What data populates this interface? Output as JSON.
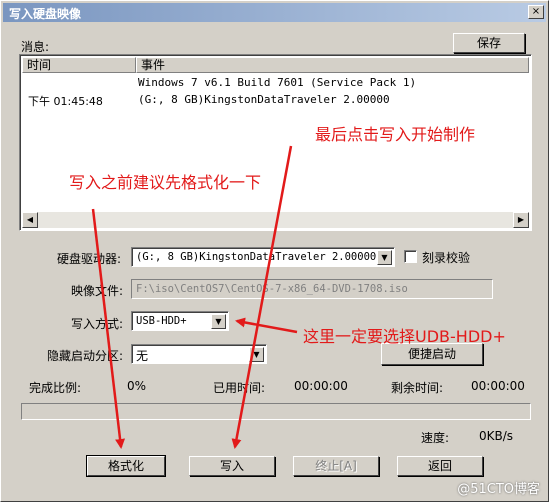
{
  "window": {
    "title": "写入硬盘映像",
    "close_glyph": "×"
  },
  "messages_label": "消息:",
  "save_button": "保存",
  "log": {
    "columns": [
      "时间",
      "事件"
    ],
    "rows": [
      {
        "time": "",
        "event": "Windows 7 v6.1 Build 7601 (Service Pack 1)"
      },
      {
        "time": "下午 01:45:48",
        "event": "(G:, 8 GB)KingstonDataTraveler 2.00000"
      }
    ]
  },
  "form": {
    "drive_label": "硬盘驱动器:",
    "drive_value": "(G:, 8 GB)KingstonDataTraveler 2.00000",
    "verify_label": "刻录校验",
    "image_label": "映像文件:",
    "image_value": "F:\\iso\\CentOS7\\CentOS-7-x86_64-DVD-1708.iso",
    "write_mode_label": "写入方式:",
    "write_mode_value": "USB-HDD+",
    "hidden_part_label": "隐藏启动分区:",
    "hidden_part_value": "无",
    "quick_boot_button": "便捷启动"
  },
  "status": {
    "ratio_label": "完成比例:",
    "ratio_value": "0%",
    "elapsed_label": "已用时间:",
    "elapsed_value": "00:00:00",
    "remaining_label": "剩余时间:",
    "remaining_value": "00:00:00",
    "speed_label": "速度:",
    "speed_value": "0KB/s",
    "progress": 0
  },
  "buttons": {
    "format": "格式化",
    "write": "写入",
    "stop": "终止[A]",
    "back": "返回"
  },
  "annotations": {
    "format_first": "写入之前建议先格式化一下",
    "click_write": "最后点击写入开始制作",
    "choose_mode": "这里一定要选择UDB-HDD+"
  },
  "watermark": "@51CTO博客",
  "colors": {
    "annotation": "#e21a1a",
    "titlebar": "#7a96c0"
  }
}
